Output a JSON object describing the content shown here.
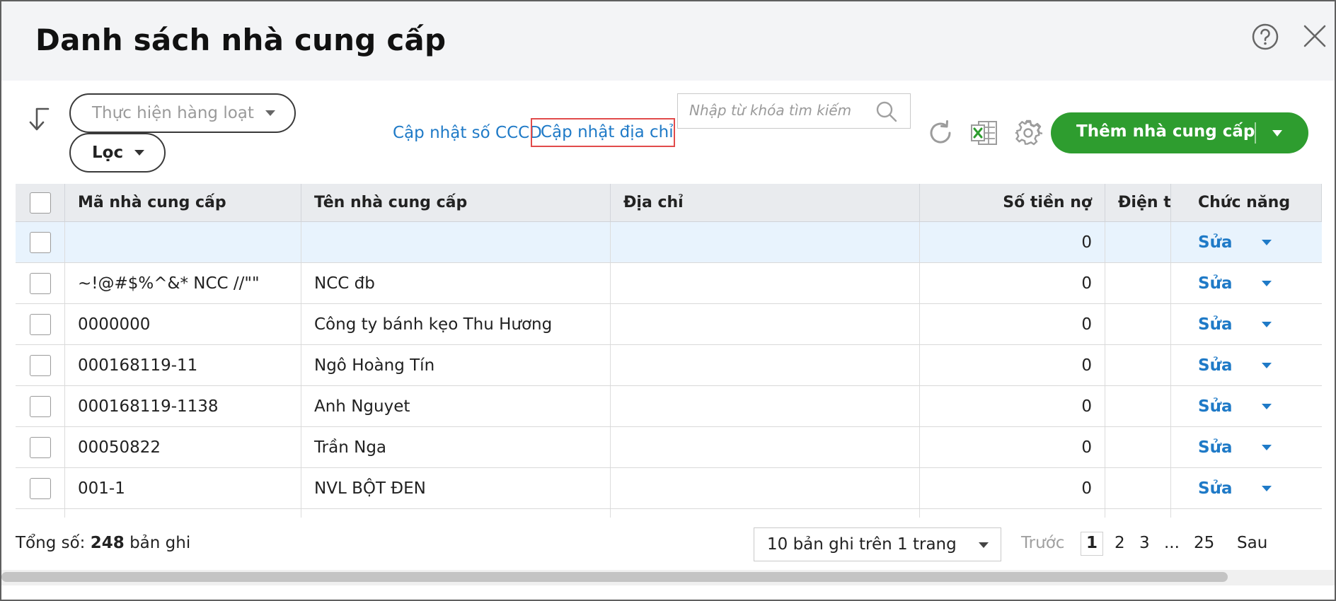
{
  "header": {
    "title": "Danh sách nhà cung cấp"
  },
  "toolbar": {
    "bulk_action_label": "Thực hiện hàng loạt",
    "filter_label": "Lọc",
    "update_cccd_label": "Cập nhật số CCCD",
    "update_address_label": "Cập nhật địa chỉ",
    "search_placeholder": "Nhập từ khóa tìm kiếm",
    "add_button_label": "Thêm nhà cung cấp"
  },
  "icons": {
    "help": "help-icon",
    "close": "close-icon",
    "sort": "sort-arrow-icon",
    "search": "search-icon",
    "refresh": "refresh-icon",
    "excel": "excel-icon",
    "settings": "gear-icon"
  },
  "colors": {
    "accent_green": "#2e9d2f",
    "link_blue": "#1f7ac7",
    "highlight_red": "#e14b4b",
    "selected_row": "#e8f3fd"
  },
  "table": {
    "columns": [
      "Mã nhà cung cấp",
      "Tên nhà cung cấp",
      "Địa chỉ",
      "Số tiền nợ",
      "Điện th",
      "Chức năng"
    ],
    "rows": [
      {
        "code": "",
        "name": "",
        "address": "",
        "debt": "0",
        "phone": "",
        "action": "Sửa"
      },
      {
        "code": "~!@#$%^&* NCC //\"\"",
        "name": "NCC đb",
        "address": "",
        "debt": "0",
        "phone": "",
        "action": "Sửa"
      },
      {
        "code": "0000000",
        "name": "Công ty bánh kẹo Thu Hương",
        "address": "",
        "debt": "0",
        "phone": "",
        "action": "Sửa"
      },
      {
        "code": "000168119-11",
        "name": "Ngô Hoàng Tín",
        "address": "",
        "debt": "0",
        "phone": "",
        "action": "Sửa"
      },
      {
        "code": "000168119-1138",
        "name": "Anh Nguyet",
        "address": "",
        "debt": "0",
        "phone": "",
        "action": "Sửa"
      },
      {
        "code": "00050822",
        "name": "Trần Nga",
        "address": "",
        "debt": "0",
        "phone": "",
        "action": "Sửa"
      },
      {
        "code": "001-1",
        "name": "NVL BỘT ĐEN",
        "address": "",
        "debt": "0",
        "phone": "",
        "action": "Sửa"
      }
    ]
  },
  "footer": {
    "total_prefix": "Tổng số:",
    "total_count": "248",
    "total_suffix": "bản ghi",
    "page_size_label": "10 bản ghi trên 1 trang",
    "prev_label": "Trước",
    "pages": [
      "1",
      "2",
      "3",
      "...",
      "25"
    ],
    "next_label": "Sau",
    "current_page": "1"
  }
}
